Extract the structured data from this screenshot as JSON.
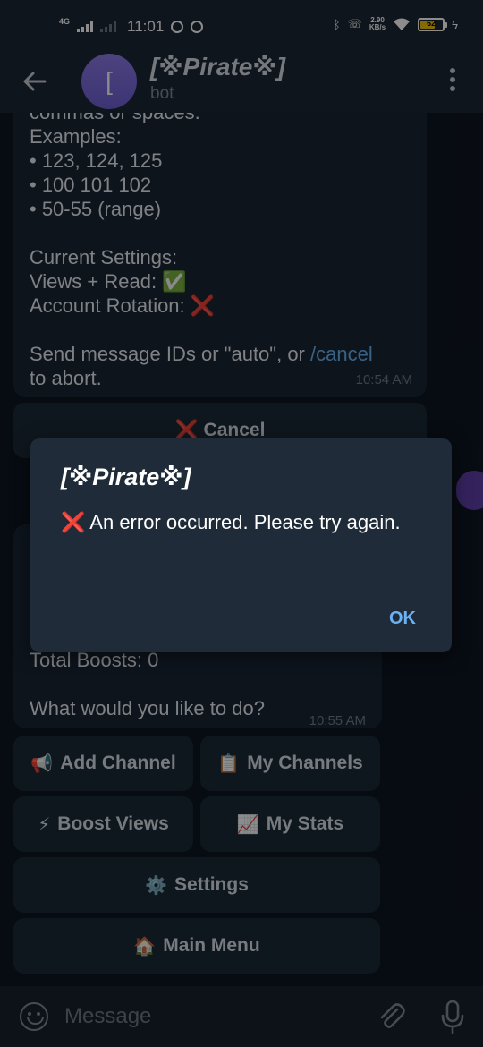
{
  "status_bar": {
    "network": "4G",
    "time": "11:01",
    "speed_value": "2.90",
    "speed_unit": "KB/s",
    "battery": "62"
  },
  "header": {
    "avatar_letter": "[",
    "title": "[※Pirate※]",
    "subtitle": "bot"
  },
  "message_1": {
    "lines": [
      "commas or spaces.",
      "Examples:",
      "• 123, 124, 125",
      "• 100 101 102",
      "• 50-55 (range)",
      "",
      "Current Settings:",
      "Views + Read: ✅",
      "Account Rotation: ❌",
      "",
      "Send message IDs or \"auto\", or "
    ],
    "link": "/cancel",
    "after_link": "to abort.",
    "time": "10:54 AM"
  },
  "cancel_button": "❌ Cancel",
  "message_2": {
    "lines": [
      "Total Boosts: 0",
      "",
      "What would you like to do?"
    ],
    "time": "10:55 AM"
  },
  "keyboard": [
    {
      "emoji": "📢",
      "label": "Add Channel"
    },
    {
      "emoji": "📋",
      "label": "My Channels"
    },
    {
      "emoji": "⚡",
      "label": "Boost Views"
    },
    {
      "emoji": "📈",
      "label": "My Stats"
    },
    {
      "emoji": "⚙️",
      "label": "Settings"
    },
    {
      "emoji": "🏠",
      "label": "Main Menu"
    }
  ],
  "dialog": {
    "title": "[※Pirate※]",
    "message": "❌ An error occurred. Please try again.",
    "ok_label": "OK"
  },
  "input": {
    "placeholder": "Message"
  },
  "colors": {
    "chat_bg": "#0e1621",
    "bubble": "#182533",
    "header": "#1d2733",
    "link": "#6ab2f2",
    "dialog": "#1f2b38"
  }
}
